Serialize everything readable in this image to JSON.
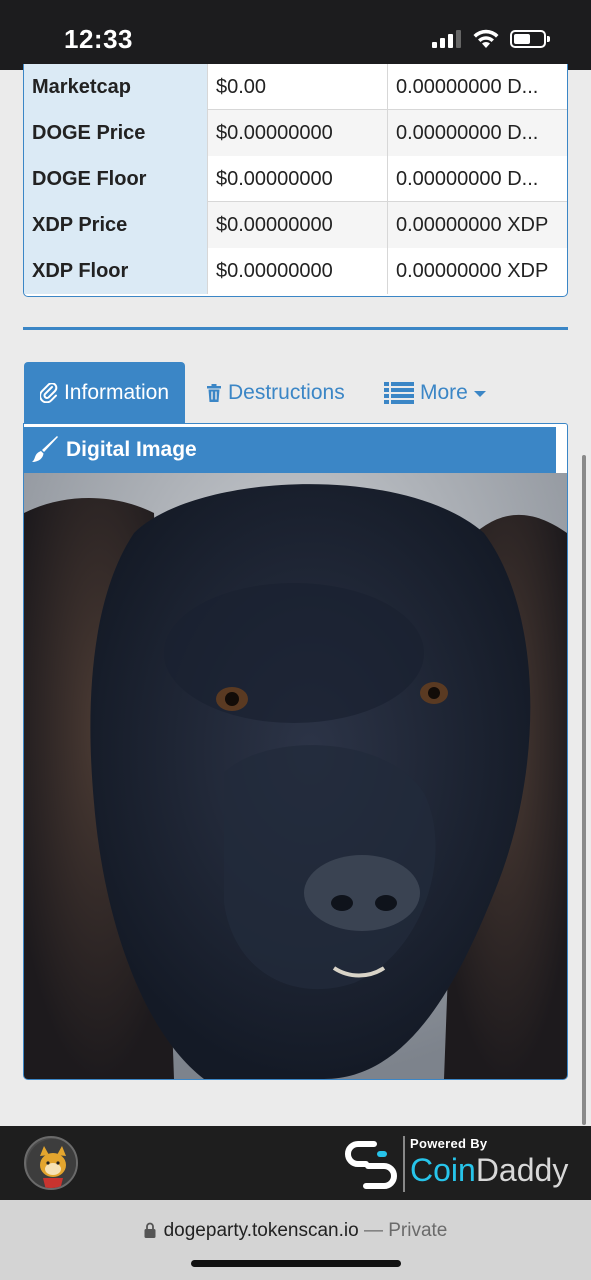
{
  "status_bar": {
    "time": "12:33"
  },
  "table": {
    "rows": [
      {
        "label": "Marketcap",
        "usd": "$0.00",
        "native": "0.00000000 D..."
      },
      {
        "label": "DOGE Price",
        "usd": "$0.00000000",
        "native": "0.00000000 D..."
      },
      {
        "label": "DOGE Floor",
        "usd": "$0.00000000",
        "native": "0.00000000 D..."
      },
      {
        "label": "XDP Price",
        "usd": "$0.00000000",
        "native": "0.00000000 XDP"
      },
      {
        "label": "XDP Floor",
        "usd": "$0.00000000",
        "native": "0.00000000 XDP"
      }
    ]
  },
  "tabs": [
    {
      "label": "Information",
      "icon": "paperclip-icon",
      "active": true
    },
    {
      "label": "Destructions",
      "icon": "trash-icon",
      "active": false
    },
    {
      "label": "More",
      "icon": "list-icon",
      "active": false
    }
  ],
  "panel": {
    "title": "Digital Image",
    "icon": "paintbrush-icon",
    "image": "black dog photo"
  },
  "footer": {
    "powered_by": "Powered By",
    "brand_part1": "Coin",
    "brand_part2": "Daddy"
  },
  "browser": {
    "domain": "dogeparty.tokenscan.io",
    "mode": "— Private"
  },
  "colors": {
    "accent": "#3b86c6",
    "label_bg": "#dbeaf5",
    "brand_cyan": "#27c4ea"
  }
}
